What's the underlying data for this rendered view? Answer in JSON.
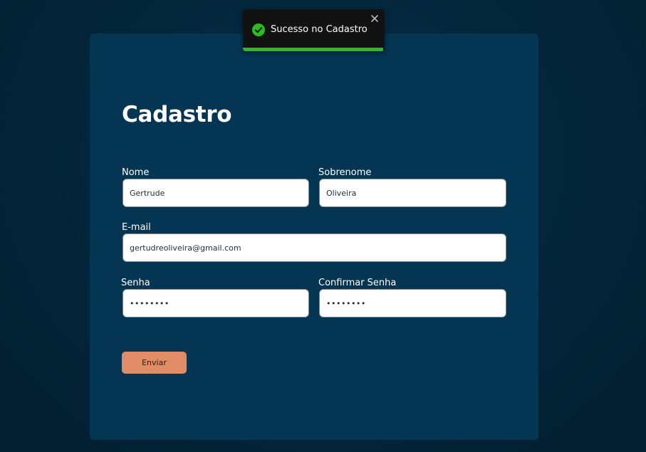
{
  "toast": {
    "message": "Sucesso no Cadastro",
    "icon": "check-circle-icon",
    "close_icon": "close-icon",
    "progress": 0.99,
    "accent_color": "#2bbd1e"
  },
  "form": {
    "title": "Cadastro",
    "fields": {
      "nome": {
        "label": "Nome",
        "value": "Gertrude"
      },
      "sobrenome": {
        "label": "Sobrenome",
        "value": "Oliveira"
      },
      "email": {
        "label": "E-mail",
        "value": "gertudreoliveira@gmail.com"
      },
      "senha": {
        "label": "Senha",
        "value": "••••••••"
      },
      "confirmar_senha": {
        "label": "Confirmar Senha",
        "value": "••••••••"
      }
    },
    "submit_label": "Enviar",
    "submit_color": "#e08c67"
  }
}
